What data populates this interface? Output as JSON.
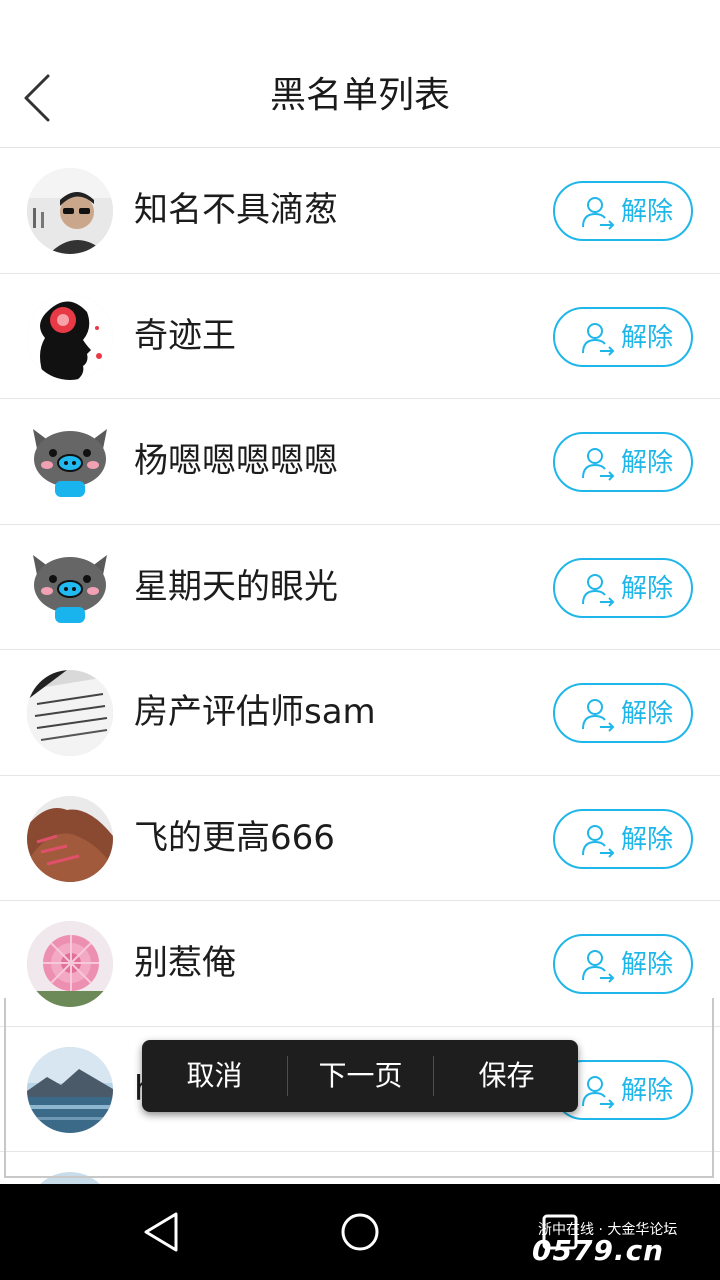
{
  "header": {
    "title": "黑名单列表",
    "back_icon": "chevron-left-icon"
  },
  "accent_color": "#1fb6ea",
  "list": {
    "items": [
      {
        "name": "知名不具滴葱",
        "action": "解除"
      },
      {
        "name": "奇迹王",
        "action": "解除"
      },
      {
        "name": "杨嗯嗯嗯嗯嗯",
        "action": "解除"
      },
      {
        "name": "星期天的眼光",
        "action": "解除"
      },
      {
        "name": "房产评估师sam",
        "action": "解除"
      },
      {
        "name": "飞的更高666",
        "action": "解除"
      },
      {
        "name": "别惹俺",
        "action": "解除"
      },
      {
        "name": "h",
        "action": "解除"
      }
    ]
  },
  "popup": {
    "cancel": "取消",
    "next_page": "下一页",
    "save": "保存"
  },
  "navbar": {
    "back_icon": "triangle-back-icon",
    "home_icon": "circle-home-icon",
    "recents_icon": "square-recents-icon"
  },
  "watermark": {
    "line1": "浙中在线 · 大金华论坛",
    "logo": "0579.cn"
  }
}
